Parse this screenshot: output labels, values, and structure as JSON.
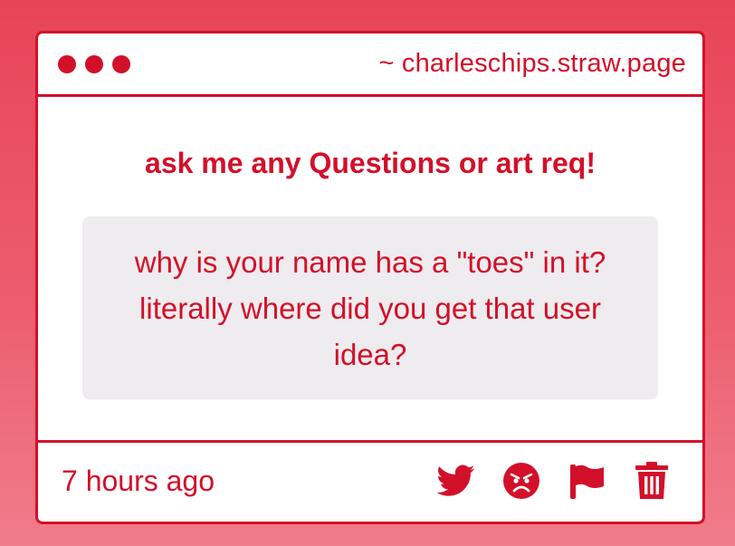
{
  "window": {
    "url": "~ charleschips.straw.page"
  },
  "content": {
    "heading": "ask me any Questions or art req!",
    "question": "why is your name has a \"toes\" in it? literally where did you get that user idea?"
  },
  "footer": {
    "timestamp": "7 hours ago",
    "actions": [
      {
        "icon": "twitter-icon"
      },
      {
        "icon": "angry-face-icon"
      },
      {
        "icon": "flag-icon"
      },
      {
        "icon": "trash-icon"
      }
    ]
  },
  "colors": {
    "accent": "#d3102a",
    "background_top": "#e84457",
    "background_bottom": "#f07d8b",
    "card": "#ffffff",
    "question_box": "#eeecee"
  }
}
